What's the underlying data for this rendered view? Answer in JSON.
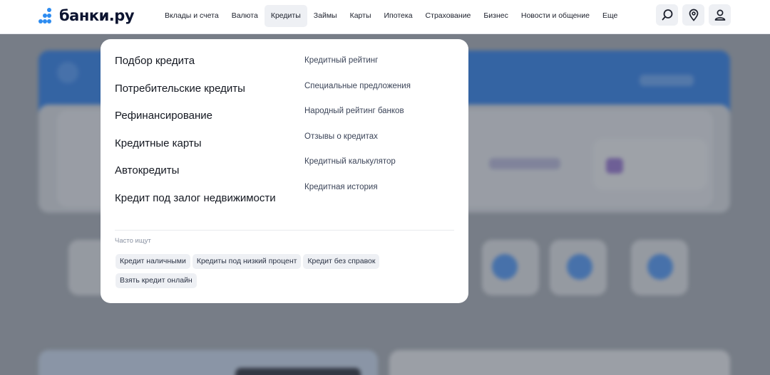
{
  "header": {
    "logo_text": "банки.ру",
    "nav": [
      "Вклады и счета",
      "Валюта",
      "Кредиты",
      "Займы",
      "Карты",
      "Ипотека",
      "Страхование",
      "Бизнес",
      "Новости и общение",
      "Еще"
    ],
    "active_nav": "Кредиты",
    "icons": [
      "search-icon",
      "location-pin-icon",
      "user-icon"
    ]
  },
  "menu": {
    "main_links": [
      "Подбор кредита",
      "Потребительские кредиты",
      "Рефинансирование",
      "Кредитные карты",
      "Автокредиты",
      "Кредит под залог недвижимости"
    ],
    "sub_links": [
      "Кредитный рейтинг",
      "Специальные предложения",
      "Народный рейтинг банков",
      "Отзывы о кредитах",
      "Кредитный калькулятор",
      "Кредитная история"
    ],
    "often_label": "Часто ищут",
    "tags": [
      "Кредит наличными",
      "Кредиты под низкий процент",
      "Кредит без справок",
      "Взять кредит онлайн"
    ]
  },
  "colors": {
    "brand": "#2d8cf0",
    "overlay": "#a8afb8",
    "panel": "#ffffff",
    "tag_bg": "#eef0f4"
  }
}
